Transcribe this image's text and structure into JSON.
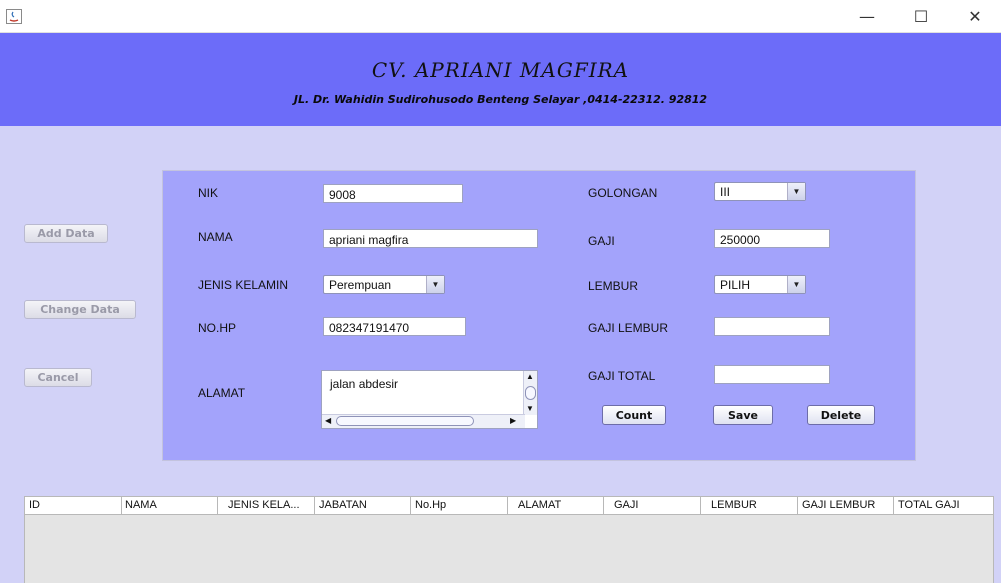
{
  "window": {
    "minimize_glyph": "—",
    "maximize_glyph": "☐",
    "close_glyph": "✕"
  },
  "header": {
    "company_name": "CV. APRIANI MAGFIRA",
    "address": "JL. Dr. Wahidin Sudirohusodo Benteng Selayar ,0414-22312. 92812",
    "background_color": "#6c6cf9"
  },
  "sidebar": {
    "add_label": "Add Data",
    "change_label": "Change Data",
    "cancel_label": "Cancel"
  },
  "form": {
    "nik_label": "NIK",
    "nik_value": "9008",
    "nama_label": "NAMA",
    "nama_value": "apriani magfira",
    "jenis_kelamin_label": "JENIS KELAMIN",
    "jenis_kelamin_value": "Perempuan",
    "nohp_label": "NO.HP",
    "nohp_value": "082347191470",
    "alamat_label": "ALAMAT",
    "alamat_value": "jalan abdesir",
    "golongan_label": "GOLONGAN",
    "golongan_value": "III",
    "gaji_label": "GAJI",
    "gaji_value": "250000",
    "lembur_label": "LEMBUR",
    "lembur_value": "PILIH",
    "gaji_lembur_label": "GAJI LEMBUR",
    "gaji_lembur_value": "",
    "gaji_total_label": "GAJI TOTAL",
    "gaji_total_value": "",
    "count_label": "Count",
    "save_label": "Save",
    "delete_label": "Delete",
    "panel_color": "#a3a3fb"
  },
  "table": {
    "columns": [
      "ID",
      "NAMA",
      "JENIS KELA...",
      "JABATAN",
      "No.Hp",
      "ALAMAT",
      "GAJI",
      "LEMBUR",
      "GAJI LEMBUR",
      "TOTAL GAJI"
    ]
  }
}
